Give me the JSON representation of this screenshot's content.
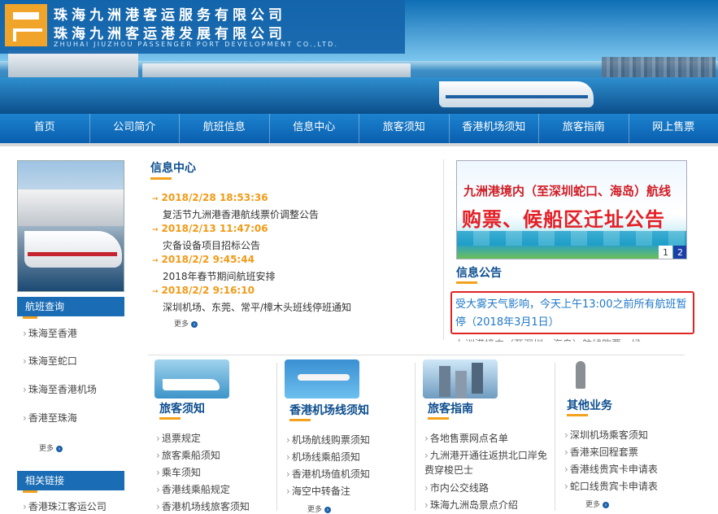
{
  "header": {
    "company_line1": "珠海九洲港客运服务有限公司",
    "company_line2": "珠海九洲客运港发展有限公司",
    "company_en": "ZHUHAI JIUZHOU PASSENGER PORT DEVELOPMENT CO.,LTD."
  },
  "nav": {
    "items": [
      "首页",
      "公司简介",
      "航班信息",
      "信息中心",
      "旅客须知",
      "香港机场须知",
      "旅客指南",
      "网上售票"
    ]
  },
  "sidebar": {
    "flight_query": {
      "title": "航班查询",
      "links": [
        "珠海至香港",
        "珠海至蛇口",
        "珠海至香港机场",
        "香港至珠海"
      ],
      "more": "更多"
    },
    "related_links": {
      "title": "相关链接",
      "links": [
        "香港珠江客运公司"
      ]
    }
  },
  "news": {
    "title": "信息中心",
    "items": [
      {
        "date": "2018/2/28 18:53:36",
        "title": "复活节九洲港香港航线票价调整公告"
      },
      {
        "date": "2018/2/13 11:47:06",
        "title": "灾备设备项目招标公告"
      },
      {
        "date": "2018/2/2 9:45:44",
        "title": "2018年春节期间航班安排"
      },
      {
        "date": "2018/2/2 9:16:10",
        "title": "深圳机场、东莞、常平/樟木头班线停班通知"
      }
    ],
    "more": "更多"
  },
  "promo": {
    "line1": "九洲港境内（至深圳蛇口、海岛）航线",
    "line2": "购票、候船区迁址公告",
    "pages": [
      "1",
      "2"
    ]
  },
  "announcement": {
    "title": "信息公告",
    "text": "受大雾天气影响，今天上午13:00之前所有航班暂停（2018年3月1日）",
    "next_text": "九洲港境内（至深圳、海岛）航线购票、候"
  },
  "blocks": [
    {
      "title": "旅客须知",
      "links": [
        "退票规定",
        "旅客乘船须知",
        "乘车须知",
        "香港线乘船规定",
        "香港机场线旅客须知"
      ]
    },
    {
      "title": "香港机场线须知",
      "links": [
        "机场航线购票须知",
        "机场线乘船须知",
        "香港机场值机须知",
        "海空中转备注"
      ],
      "more": "更多"
    },
    {
      "title": "旅客指南",
      "links": [
        "各地售票网点名单",
        "九洲港开通往返拱北口岸免费穿梭巴士",
        "市内公交线路",
        "珠海九洲岛景点介绍"
      ]
    },
    {
      "title": "其他业务",
      "links": [
        "深圳机场乘客须知",
        "香港来回程套票",
        "香港线贵宾卡申请表",
        "蛇口线贵宾卡申请表"
      ],
      "more": "更多"
    }
  ],
  "colors": {
    "nav_blue": "#0a5fae",
    "accent_orange": "#f29a16",
    "title_blue": "#0c4e8f",
    "alert_red": "#e02424"
  }
}
